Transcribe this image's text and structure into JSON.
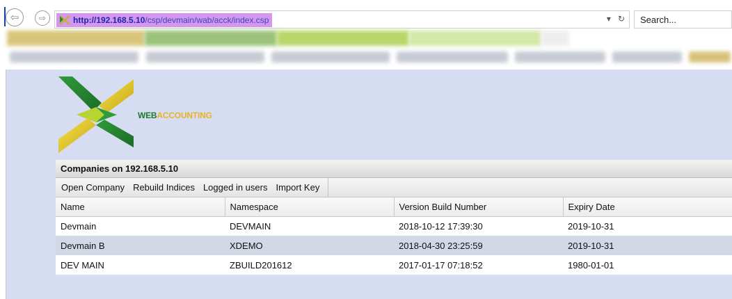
{
  "browser": {
    "url_host": "http://192.168.5.10",
    "url_path": "/csp/devmain/wab/acck/index.csp",
    "refresh_icon": "refresh-icon",
    "search_placeholder": "Search..."
  },
  "app": {
    "logo": {
      "brand_word_1": "WEB",
      "brand_word_2": "ACCOUNTING"
    },
    "panel_title": "Companies on 192.168.5.10",
    "toolbar": [
      "Open Company",
      "Rebuild Indices",
      "Logged in users",
      "Import Key"
    ],
    "columns": [
      "Name",
      "Namespace",
      "Version Build Number",
      "Expiry Date"
    ],
    "rows": [
      {
        "name": "Devmain",
        "namespace": "DEVMAIN",
        "build": "2018-10-12 17:39:30",
        "expiry": "2019-10-31",
        "selected": false
      },
      {
        "name": "Devmain B",
        "namespace": "XDEMO",
        "build": "2018-04-30 23:25:59",
        "expiry": "2019-10-31",
        "selected": true
      },
      {
        "name": "DEV MAIN",
        "namespace": "ZBUILD201612",
        "build": "2017-01-17 07:18:52",
        "expiry": "1980-01-01",
        "selected": false
      }
    ]
  },
  "colors": {
    "app_background": "#d6dcf2",
    "selected_row": "#d2d8e6",
    "url_highlight": "#d596f0",
    "logo_green": "#1e7a2a",
    "logo_yellow": "#e8b320"
  }
}
